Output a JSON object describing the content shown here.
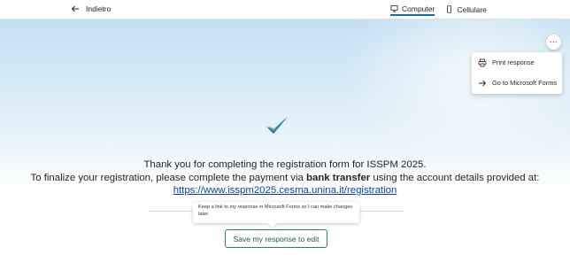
{
  "topbar": {
    "back_label": "Indietro",
    "tabs": [
      {
        "label": "Computer",
        "icon": "monitor-icon",
        "active": true
      },
      {
        "label": "Cellulare",
        "icon": "phone-icon",
        "active": false
      }
    ]
  },
  "menu": {
    "more_label": "...",
    "items": [
      {
        "label": "Print response",
        "icon": "printer-icon"
      },
      {
        "label": "Go to Microsoft Forms",
        "icon": "arrow-right-icon"
      }
    ]
  },
  "message": {
    "line1": "Thank you for completing the registration form for ISSPM 2025.",
    "line2_prefix": "To finalize your registration, please complete the payment via ",
    "line2_bold": "bank transfer",
    "line2_suffix": " using the account details provided at:",
    "link": "https://www.isspm2025.cesma.unina.it/registration"
  },
  "tooltip": {
    "text": "Keep a link to my response in Microsoft Forms so I can make changes later."
  },
  "save_button": {
    "label": "Save my response to edit"
  },
  "colors": {
    "accent": "#0f6cbd",
    "link": "#0b3fb5",
    "save_border": "#2e7d6f",
    "check_blue": "#1f6fd1",
    "check_green": "#7bc043"
  }
}
